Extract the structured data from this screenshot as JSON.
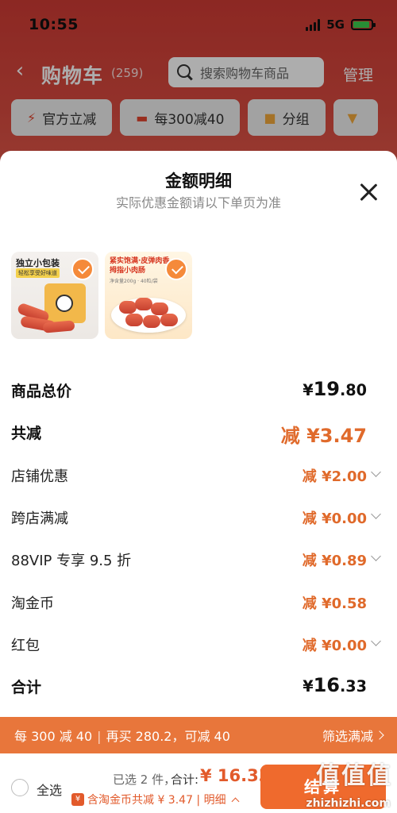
{
  "status_bar": {
    "time": "10:55",
    "network": "5G"
  },
  "nav": {
    "title": "购物车",
    "count": "(259)",
    "search_placeholder": "搜索购物车商品",
    "manage": "管理"
  },
  "filters": [
    {
      "label": "官方立减",
      "icon": "lightning-icon"
    },
    {
      "label": "每300减40",
      "icon": "coupon-icon"
    },
    {
      "label": "分组",
      "icon": "folder-icon"
    },
    {
      "label": "",
      "icon": "more-icon"
    }
  ],
  "sheet": {
    "title": "金额明细",
    "subtitle": "实际优惠金额请以下单页为准",
    "products": [
      {
        "label": "独立小包装",
        "sub": "轻松享受好味道"
      },
      {
        "label": "紧实饱满·皮弹肉香 拇指小肉肠",
        "sub": "净含量200g · 40粒/袋"
      }
    ],
    "rows": {
      "goods_total": {
        "label": "商品总价",
        "currency": "¥",
        "int": "19",
        "dec": ".80"
      },
      "total_discount": {
        "label": "共减",
        "value": "减 ¥3.47"
      },
      "shop_discount": {
        "label": "店铺优惠",
        "value": "减 ¥2.00"
      },
      "cross_shop": {
        "label": "跨店满减",
        "value": "减 ¥0.00"
      },
      "vip": {
        "label": "88VIP 专享 9.5 折",
        "value": "减 ¥0.89"
      },
      "gold_coin": {
        "label": "淘金币",
        "value": "减 ¥0.58"
      },
      "red_packet": {
        "label": "红包",
        "value": "减 ¥0.00"
      },
      "sum": {
        "label": "合计",
        "currency": "¥",
        "int": "16",
        "dec": ".33"
      }
    }
  },
  "promo": {
    "part1": "每 300 减 40",
    "part2": "再买 280.2，可减 40",
    "link": "筛选满减"
  },
  "checkout": {
    "select_all": "全选",
    "selected_count": "已选 2 件，",
    "total_label": "合计:",
    "total_value": "¥ 16.33",
    "coin_line": "含淘金币共减 ¥ 3.47 | 明细",
    "button": "结算",
    "watermark": "值值值",
    "watermark_url": "zhizhizhi.com"
  },
  "colors": {
    "accent_orange": "#e8763b",
    "discount_text": "#e06a2b",
    "header_red": "#cf3b34"
  }
}
